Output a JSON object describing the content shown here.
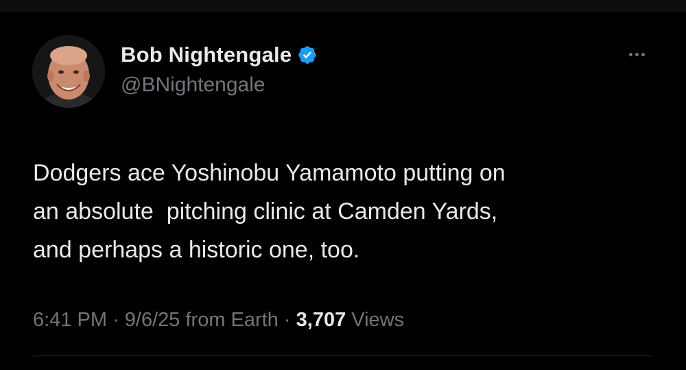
{
  "author": {
    "display_name": "Bob Nightengale",
    "handle": "@BNightengale",
    "verified": true,
    "verified_color": "#1d9bf0"
  },
  "tweet": {
    "text_lines": [
      "Dodgers ace Yoshinobu Yamamoto putting on",
      "an absolute  pitching clinic at Camden Yards,",
      "and perhaps a historic one, too."
    ],
    "time": "6:41 PM",
    "separator": " · ",
    "date": "9/6/25",
    "source": "from Earth",
    "views_count": "3,707",
    "views_label": "Views"
  },
  "icons": {
    "more": "more-horizontal-icon",
    "verified": "verified-badge-icon"
  },
  "colors": {
    "background": "#000000",
    "primary_text": "#e7e9ea",
    "secondary_text": "#71767b",
    "divider": "#2f3336"
  }
}
